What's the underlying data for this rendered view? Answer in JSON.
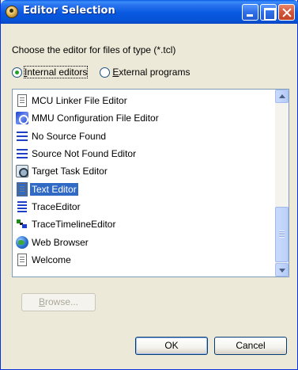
{
  "window": {
    "title": "Editor Selection"
  },
  "prompt": "Choose the editor for files of type (*.tcl)",
  "radios": {
    "internal": {
      "pre": "",
      "mnemonic": "I",
      "post": "nternal editors",
      "checked": true
    },
    "external": {
      "pre": "",
      "mnemonic": "E",
      "post": "xternal programs",
      "checked": false
    }
  },
  "editors": [
    {
      "label": "MCU Linker File Editor",
      "icon": "document-icon"
    },
    {
      "label": "MMU Configuration File Editor",
      "icon": "mmu-config-icon"
    },
    {
      "label": "No Source Found",
      "icon": "lines-icon"
    },
    {
      "label": "Source Not Found Editor",
      "icon": "lines-icon"
    },
    {
      "label": "Target Task Editor",
      "icon": "target-task-icon"
    },
    {
      "label": "Text Editor",
      "icon": "document-icon",
      "selected": true
    },
    {
      "label": "TraceEditor",
      "icon": "trace-icon"
    },
    {
      "label": "TraceTimelineEditor",
      "icon": "timeline-icon"
    },
    {
      "label": "Web Browser",
      "icon": "globe-icon"
    },
    {
      "label": "Welcome",
      "icon": "document-icon"
    }
  ],
  "buttons": {
    "browse": {
      "pre": "",
      "mnemonic": "B",
      "post": "rowse...",
      "enabled": false
    },
    "ok": "OK",
    "cancel": "Cancel"
  },
  "colors": {
    "selection": "#316AC5",
    "title_bar": "#0858E0",
    "dialog_bg": "#ECE9D8"
  }
}
